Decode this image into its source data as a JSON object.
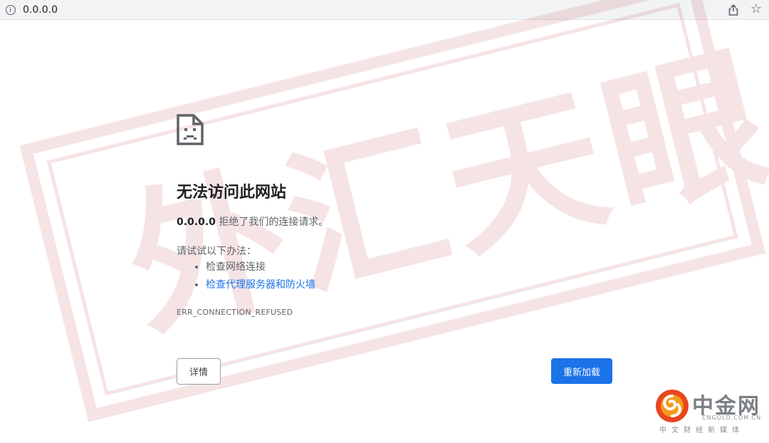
{
  "browser": {
    "url": "0.0.0.0"
  },
  "watermark": {
    "text": "外汇天眼",
    "color": "#b3131b"
  },
  "error": {
    "title": "无法访问此网站",
    "host": "0.0.0.0",
    "message": "拒绝了我们的连接请求。",
    "suggest_label": "请试试以下办法：",
    "suggestions": [
      {
        "label": "检查网络连接",
        "link": false
      },
      {
        "label": "检查代理服务器和防火墙",
        "link": true
      }
    ],
    "code": "ERR_CONNECTION_REFUSED",
    "details_label": "详情",
    "reload_label": "重新加载",
    "accent_color": "#1a73e8"
  },
  "brand": {
    "name": "中金网",
    "domain": "CNGOLD.COM.CN",
    "slogan": "中文财经新媒体"
  }
}
